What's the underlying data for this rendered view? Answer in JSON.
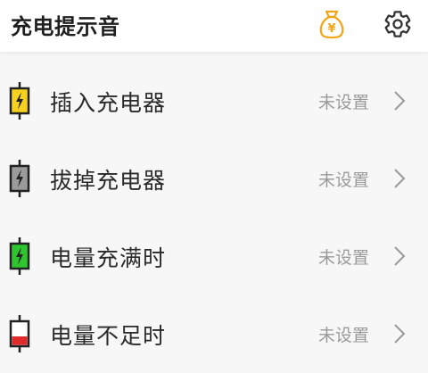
{
  "header": {
    "title": "充电提示音",
    "money_icon_symbol": "¥"
  },
  "icons": {
    "money": "money-bag-icon",
    "settings": "gear-icon",
    "chevron": "chevron-right-icon"
  },
  "colors": {
    "money_icon": "#f2a516",
    "plug_in": "#f6d21f",
    "unplug": "#9b9b9b",
    "full": "#2fc52f",
    "low": "#e12a2a"
  },
  "items": [
    {
      "label": "插入充电器",
      "value": "未设置"
    },
    {
      "label": "拔掉充电器",
      "value": "未设置"
    },
    {
      "label": "电量充满时",
      "value": "未设置"
    },
    {
      "label": "电量不足时",
      "value": "未设置"
    }
  ]
}
